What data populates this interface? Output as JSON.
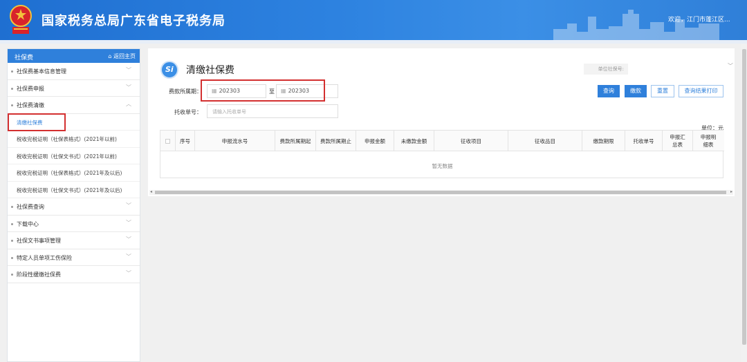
{
  "header": {
    "title": "国家税务总局广东省电子税务局",
    "welcome": "欢迎，江门市蓬江区..."
  },
  "sidebar": {
    "title": "社保费",
    "home_link": "⌂ 返回主页",
    "items": [
      {
        "label": "社保费基本信息管理"
      },
      {
        "label": "社保费申报"
      },
      {
        "label": "社保费清缴"
      },
      {
        "label": "清缴社保费",
        "active": true
      },
      {
        "label": "税收完税证明（社保表格式）(2021年以前)"
      },
      {
        "label": "税收完税证明（社保文书式）(2021年以前)"
      },
      {
        "label": "税收完税证明（社保表格式）(2021年及以后)"
      },
      {
        "label": "税收完税证明（社保文书式）(2021年及以后)"
      },
      {
        "label": "社保费查询"
      },
      {
        "label": "下载中心"
      },
      {
        "label": "社保文书事项管理"
      },
      {
        "label": "特定人员单项工伤保险"
      },
      {
        "label": "阶段性缓缴社保费"
      }
    ]
  },
  "page": {
    "icon_text": "Si",
    "title": "清缴社保费",
    "unit_no_label": "单位社保号:",
    "period_label": "费款所属期：",
    "period_start": "202303",
    "period_to": "至",
    "period_end": "202303",
    "order_label": "托收单号：",
    "order_placeholder": "请输入托收单号",
    "buttons": {
      "query": "查询",
      "pay": "缴款",
      "reset": "重置",
      "print": "查询结果打印"
    },
    "unit_text": "单位：元",
    "table": {
      "headers": [
        "序号",
        "申报流水号",
        "费款所属期起",
        "费款所属期止",
        "申报金额",
        "未缴款金额",
        "征收项目",
        "征收品目",
        "缴款期限",
        "托收单号",
        "申报汇总表",
        "申报明细表"
      ],
      "empty_text": "暂无数据"
    }
  },
  "colors": {
    "brand_blue": "#2f80db",
    "highlight_red": "#d32f2f"
  }
}
